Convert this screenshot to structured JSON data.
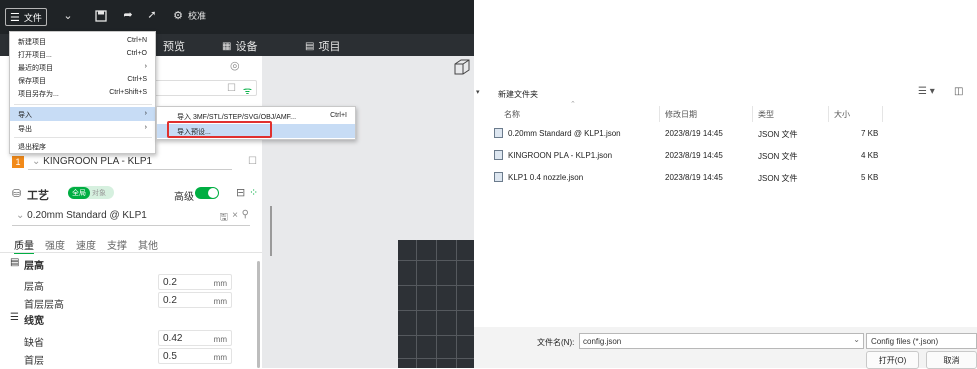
{
  "toolbar": {
    "file_label": "文件",
    "calibrate_label": "校准"
  },
  "tabs": {
    "preview": "预览",
    "device": "设备",
    "project": "项目"
  },
  "file_menu": [
    {
      "label": "新建项目",
      "shortcut": "Ctrl+N"
    },
    {
      "label": "打开项目...",
      "shortcut": "Ctrl+O"
    },
    {
      "label": "最近的项目",
      "shortcut": "›"
    },
    {
      "label": "保存项目",
      "shortcut": "Ctrl+S"
    },
    {
      "label": "项目另存为...",
      "shortcut": "Ctrl+Shift+S"
    },
    {
      "label": "导入",
      "shortcut": "›"
    },
    {
      "label": "导出",
      "shortcut": "›"
    },
    {
      "label": "退出程序",
      "shortcut": ""
    }
  ],
  "import_submenu": [
    {
      "label": "导入 3MF/STL/STEP/SVG/OBJ/AMF...",
      "shortcut": "Ctrl+I"
    },
    {
      "label": "导入预设..."
    }
  ],
  "panel": {
    "filament_index": "1",
    "filament_name": "KINGROON PLA - KLP1",
    "process_title": "工艺",
    "global_badge": "全局",
    "object_badge": "对象",
    "advanced_label": "高级",
    "process_preset": "0.20mm Standard @ KLP1",
    "subtabs": [
      "质量",
      "强度",
      "速度",
      "支撑",
      "其他"
    ],
    "section_layer_height": "层高",
    "layer_height_label": "层高",
    "layer_height_value": "0.2",
    "first_layer_height_label": "首层层高",
    "first_layer_height_value": "0.2",
    "section_line_width": "线宽",
    "default_width_label": "缺省",
    "default_width_value": "0.42",
    "first_layer_width_label": "首层",
    "first_layer_width_value": "0.5",
    "unit": "mm"
  },
  "dialog": {
    "new_folder": "新建文件夹",
    "columns": {
      "name": "名称",
      "date": "修改日期",
      "type": "类型",
      "size": "大小"
    },
    "files": [
      {
        "name": "0.20mm Standard @ KLP1.json",
        "date": "2023/8/19 14:45",
        "type": "JSON 文件",
        "size": "7 KB"
      },
      {
        "name": "KINGROON PLA - KLP1.json",
        "date": "2023/8/19 14:45",
        "type": "JSON 文件",
        "size": "4 KB"
      },
      {
        "name": "KLP1 0.4 nozzle.json",
        "date": "2023/8/19 14:45",
        "type": "JSON 文件",
        "size": "5 KB"
      }
    ],
    "filename_label": "文件名(N):",
    "filename_value": "config.json",
    "filter_value": "Config files (*.json)",
    "open_button": "打开(O)",
    "cancel_button": "取消"
  },
  "colors": {
    "accent": "#00ae42",
    "highlight_box": "#e0312f",
    "menu_highlight": "#c7dcf5",
    "dark_toolbar": "#1f2326"
  }
}
